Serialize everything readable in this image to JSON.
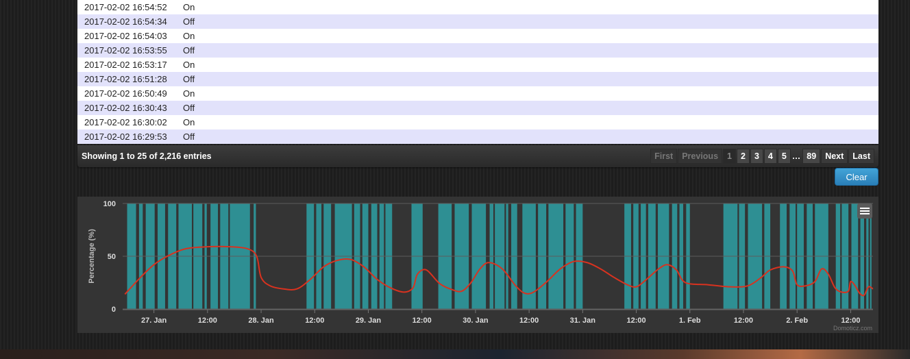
{
  "log": {
    "rows": [
      {
        "date": "2017-02-02 16:54:52",
        "state": "On"
      },
      {
        "date": "2017-02-02 16:54:34",
        "state": "Off"
      },
      {
        "date": "2017-02-02 16:54:03",
        "state": "On"
      },
      {
        "date": "2017-02-02 16:53:55",
        "state": "Off"
      },
      {
        "date": "2017-02-02 16:53:17",
        "state": "On"
      },
      {
        "date": "2017-02-02 16:51:28",
        "state": "Off"
      },
      {
        "date": "2017-02-02 16:50:49",
        "state": "On"
      },
      {
        "date": "2017-02-02 16:30:43",
        "state": "Off"
      },
      {
        "date": "2017-02-02 16:30:02",
        "state": "On"
      },
      {
        "date": "2017-02-02 16:29:53",
        "state": "Off"
      }
    ],
    "info": "Showing 1 to 25 of 2,216 entries",
    "pager": {
      "first": "First",
      "previous": "Previous",
      "pages": [
        "1",
        "2",
        "3",
        "4",
        "5"
      ],
      "ellipsis": "…",
      "last_page": "89",
      "next": "Next",
      "last": "Last",
      "current": "1"
    }
  },
  "clear_button": "Clear",
  "menu_icon": "hamburger-menu-icon",
  "credit": "Domoticz.com",
  "colors": {
    "on_band": "#2e8f93",
    "line": "#d9321f",
    "panel": "#343434"
  },
  "chart_data": {
    "type": "area",
    "ylabel": "Percentage (%)",
    "ylim": [
      0,
      100
    ],
    "yticks": [
      0,
      50,
      100
    ],
    "xlim": [
      "2017-01-26 17:00",
      "2017-02-02 17:00"
    ],
    "xticks": [
      {
        "t": "2017-01-27 00:00",
        "label": "27. Jan"
      },
      {
        "t": "2017-01-27 12:00",
        "label": "12:00"
      },
      {
        "t": "2017-01-28 00:00",
        "label": "28. Jan"
      },
      {
        "t": "2017-01-28 12:00",
        "label": "12:00"
      },
      {
        "t": "2017-01-29 00:00",
        "label": "29. Jan"
      },
      {
        "t": "2017-01-29 12:00",
        "label": "12:00"
      },
      {
        "t": "2017-01-30 00:00",
        "label": "30. Jan"
      },
      {
        "t": "2017-01-30 12:00",
        "label": "12:00"
      },
      {
        "t": "2017-01-31 00:00",
        "label": "31. Jan"
      },
      {
        "t": "2017-01-31 12:00",
        "label": "12:00"
      },
      {
        "t": "2017-02-01 00:00",
        "label": "1. Feb"
      },
      {
        "t": "2017-02-01 12:00",
        "label": "12:00"
      },
      {
        "t": "2017-02-02 00:00",
        "label": "2. Feb"
      },
      {
        "t": "2017-02-02 12:00",
        "label": "12:00"
      }
    ],
    "on_periods": [
      [
        "2017-01-26 18:00",
        "2017-01-26 20:00"
      ],
      [
        "2017-01-26 20:40",
        "2017-01-26 21:30"
      ],
      [
        "2017-01-26 22:10",
        "2017-01-27 00:10"
      ],
      [
        "2017-01-27 00:50",
        "2017-01-27 02:30"
      ],
      [
        "2017-01-27 03:10",
        "2017-01-27 05:00"
      ],
      [
        "2017-01-27 05:30",
        "2017-01-27 08:30"
      ],
      [
        "2017-01-27 08:50",
        "2017-01-27 10:50"
      ],
      [
        "2017-01-27 11:20",
        "2017-01-27 11:50"
      ],
      [
        "2017-01-27 12:40",
        "2017-01-27 14:20"
      ],
      [
        "2017-01-27 14:50",
        "2017-01-27 16:40"
      ],
      [
        "2017-01-27 17:00",
        "2017-01-27 21:30"
      ],
      [
        "2017-01-27 22:20",
        "2017-01-27 22:50"
      ],
      [
        "2017-01-28 10:10",
        "2017-01-28 11:50"
      ],
      [
        "2017-01-28 12:20",
        "2017-01-28 13:30"
      ],
      [
        "2017-01-28 14:00",
        "2017-01-28 15:40"
      ],
      [
        "2017-01-28 16:30",
        "2017-01-28 20:20"
      ],
      [
        "2017-01-28 20:50",
        "2017-01-28 22:10"
      ],
      [
        "2017-01-28 22:40",
        "2017-01-29 00:00"
      ],
      [
        "2017-01-29 00:40",
        "2017-01-29 02:00"
      ],
      [
        "2017-01-29 02:30",
        "2017-01-29 03:30"
      ],
      [
        "2017-01-29 03:50",
        "2017-01-29 05:20"
      ],
      [
        "2017-01-29 09:40",
        "2017-01-29 12:10"
      ],
      [
        "2017-01-29 15:40",
        "2017-01-29 18:40"
      ],
      [
        "2017-01-29 19:20",
        "2017-01-29 22:30"
      ],
      [
        "2017-01-29 23:10",
        "2017-01-30 02:20"
      ],
      [
        "2017-01-30 03:10",
        "2017-01-30 04:00"
      ],
      [
        "2017-01-30 04:20",
        "2017-01-30 06:30"
      ],
      [
        "2017-01-30 06:50",
        "2017-01-30 07:20"
      ],
      [
        "2017-01-30 08:00",
        "2017-01-30 09:20"
      ],
      [
        "2017-01-30 10:30",
        "2017-01-30 13:30"
      ],
      [
        "2017-01-30 14:00",
        "2017-01-30 15:50"
      ],
      [
        "2017-01-30 16:20",
        "2017-01-30 19:40"
      ],
      [
        "2017-01-30 20:10",
        "2017-01-30 22:00"
      ],
      [
        "2017-01-30 22:30",
        "2017-01-31 00:00"
      ],
      [
        "2017-01-31 09:20",
        "2017-01-31 10:50"
      ],
      [
        "2017-01-31 11:20",
        "2017-01-31 12:30"
      ],
      [
        "2017-01-31 13:00",
        "2017-01-31 14:10"
      ],
      [
        "2017-01-31 14:40",
        "2017-01-31 16:20"
      ],
      [
        "2017-01-31 16:50",
        "2017-01-31 19:20"
      ],
      [
        "2017-01-31 20:00",
        "2017-01-31 21:10"
      ],
      [
        "2017-01-31 21:40",
        "2017-01-31 22:30"
      ],
      [
        "2017-01-31 23:10",
        "2017-02-01 00:00"
      ],
      [
        "2017-02-01 07:30",
        "2017-02-01 10:40"
      ],
      [
        "2017-02-01 11:00",
        "2017-02-01 12:20"
      ],
      [
        "2017-02-01 13:00",
        "2017-02-01 16:10"
      ],
      [
        "2017-02-01 16:40",
        "2017-02-01 18:00"
      ],
      [
        "2017-02-01 20:10",
        "2017-02-01 21:40"
      ],
      [
        "2017-02-01 22:20",
        "2017-02-01 23:40"
      ],
      [
        "2017-02-02 00:00",
        "2017-02-02 01:30"
      ],
      [
        "2017-02-02 02:10",
        "2017-02-02 03:30"
      ],
      [
        "2017-02-02 04:00",
        "2017-02-02 07:00"
      ],
      [
        "2017-02-02 08:40",
        "2017-02-02 09:40"
      ],
      [
        "2017-02-02 10:00",
        "2017-02-02 11:30"
      ],
      [
        "2017-02-02 12:10",
        "2017-02-02 13:40"
      ],
      [
        "2017-02-02 14:10",
        "2017-02-02 15:00"
      ],
      [
        "2017-02-02 15:30",
        "2017-02-02 16:00"
      ],
      [
        "2017-02-02 16:20",
        "2017-02-02 16:40"
      ]
    ],
    "trend": [
      [
        "2017-01-26 17:30",
        14
      ],
      [
        "2017-01-26 21:00",
        30
      ],
      [
        "2017-01-27 00:00",
        42
      ],
      [
        "2017-01-27 03:00",
        50
      ],
      [
        "2017-01-27 07:00",
        57
      ],
      [
        "2017-01-27 12:00",
        59
      ],
      [
        "2017-01-27 17:00",
        59
      ],
      [
        "2017-01-27 21:00",
        57
      ],
      [
        "2017-01-27 23:00",
        50
      ],
      [
        "2017-01-28 00:00",
        30
      ],
      [
        "2017-01-28 02:00",
        22
      ],
      [
        "2017-01-28 05:00",
        19
      ],
      [
        "2017-01-28 08:00",
        19
      ],
      [
        "2017-01-28 11:00",
        28
      ],
      [
        "2017-01-28 14:00",
        40
      ],
      [
        "2017-01-28 17:00",
        46
      ],
      [
        "2017-01-28 20:00",
        47
      ],
      [
        "2017-01-28 23:00",
        40
      ],
      [
        "2017-01-29 02:00",
        28
      ],
      [
        "2017-01-29 05:00",
        20
      ],
      [
        "2017-01-29 08:00",
        16
      ],
      [
        "2017-01-29 10:00",
        20
      ],
      [
        "2017-01-29 11:00",
        33
      ],
      [
        "2017-01-29 13:00",
        37
      ],
      [
        "2017-01-29 16:00",
        24
      ],
      [
        "2017-01-29 19:00",
        18
      ],
      [
        "2017-01-29 21:00",
        17
      ],
      [
        "2017-01-29 23:00",
        25
      ],
      [
        "2017-01-30 01:00",
        38
      ],
      [
        "2017-01-30 03:00",
        44
      ],
      [
        "2017-01-30 06:00",
        38
      ],
      [
        "2017-01-30 09:00",
        22
      ],
      [
        "2017-01-30 11:00",
        15
      ],
      [
        "2017-01-30 13:00",
        16
      ],
      [
        "2017-01-30 16:00",
        26
      ],
      [
        "2017-01-30 19:00",
        38
      ],
      [
        "2017-01-30 22:00",
        45
      ],
      [
        "2017-01-31 01:00",
        44
      ],
      [
        "2017-01-31 04:00",
        38
      ],
      [
        "2017-01-31 07:00",
        30
      ],
      [
        "2017-01-31 10:00",
        23
      ],
      [
        "2017-01-31 12:00",
        21
      ],
      [
        "2017-01-31 14:00",
        27
      ],
      [
        "2017-01-31 17:00",
        38
      ],
      [
        "2017-01-31 19:00",
        42
      ],
      [
        "2017-01-31 21:00",
        37
      ],
      [
        "2017-01-31 23:00",
        25
      ],
      [
        "2017-02-01 04:00",
        23
      ],
      [
        "2017-02-01 09:00",
        21
      ],
      [
        "2017-02-01 13:00",
        22
      ],
      [
        "2017-02-01 16:00",
        30
      ],
      [
        "2017-02-01 18:00",
        37
      ],
      [
        "2017-02-01 21:00",
        40
      ],
      [
        "2017-02-01 23:00",
        36
      ],
      [
        "2017-02-02 00:00",
        23
      ],
      [
        "2017-02-02 02:00",
        22
      ],
      [
        "2017-02-02 04:00",
        26
      ],
      [
        "2017-02-02 05:30",
        38
      ],
      [
        "2017-02-02 07:00",
        33
      ],
      [
        "2017-02-02 08:30",
        20
      ],
      [
        "2017-02-02 10:00",
        16
      ],
      [
        "2017-02-02 11:30",
        17
      ],
      [
        "2017-02-02 12:00",
        26
      ],
      [
        "2017-02-02 13:00",
        22
      ],
      [
        "2017-02-02 14:00",
        15
      ],
      [
        "2017-02-02 15:00",
        13
      ],
      [
        "2017-02-02 16:00",
        21
      ],
      [
        "2017-02-02 17:00",
        19
      ]
    ]
  }
}
